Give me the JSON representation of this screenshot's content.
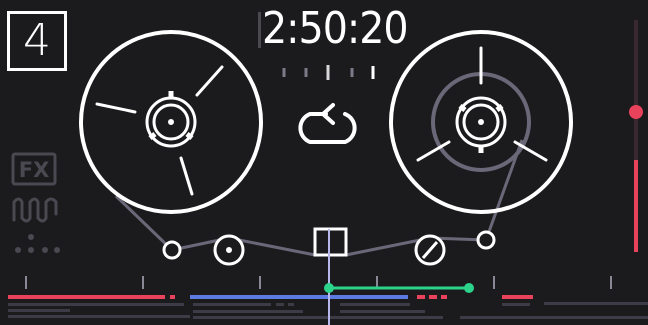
{
  "track": {
    "number": "4"
  },
  "counter": {
    "time": "2:50:20"
  },
  "fx": {
    "label": "FX"
  },
  "colors": {
    "background": "#1b1b1d",
    "foreground": "#ffffff",
    "level_red": "#e8435a",
    "loop_blue": "#5d7ae0",
    "selection_green": "#2bd38b",
    "dim": "#3d3b45",
    "tape_path": "#6a6878"
  },
  "icons": {
    "loop": "loop-arrow-icon",
    "fx": "fx-icon",
    "waveform": "waveform-icon",
    "dots": "dots-grid-icon",
    "playhead": "playhead-icon"
  }
}
